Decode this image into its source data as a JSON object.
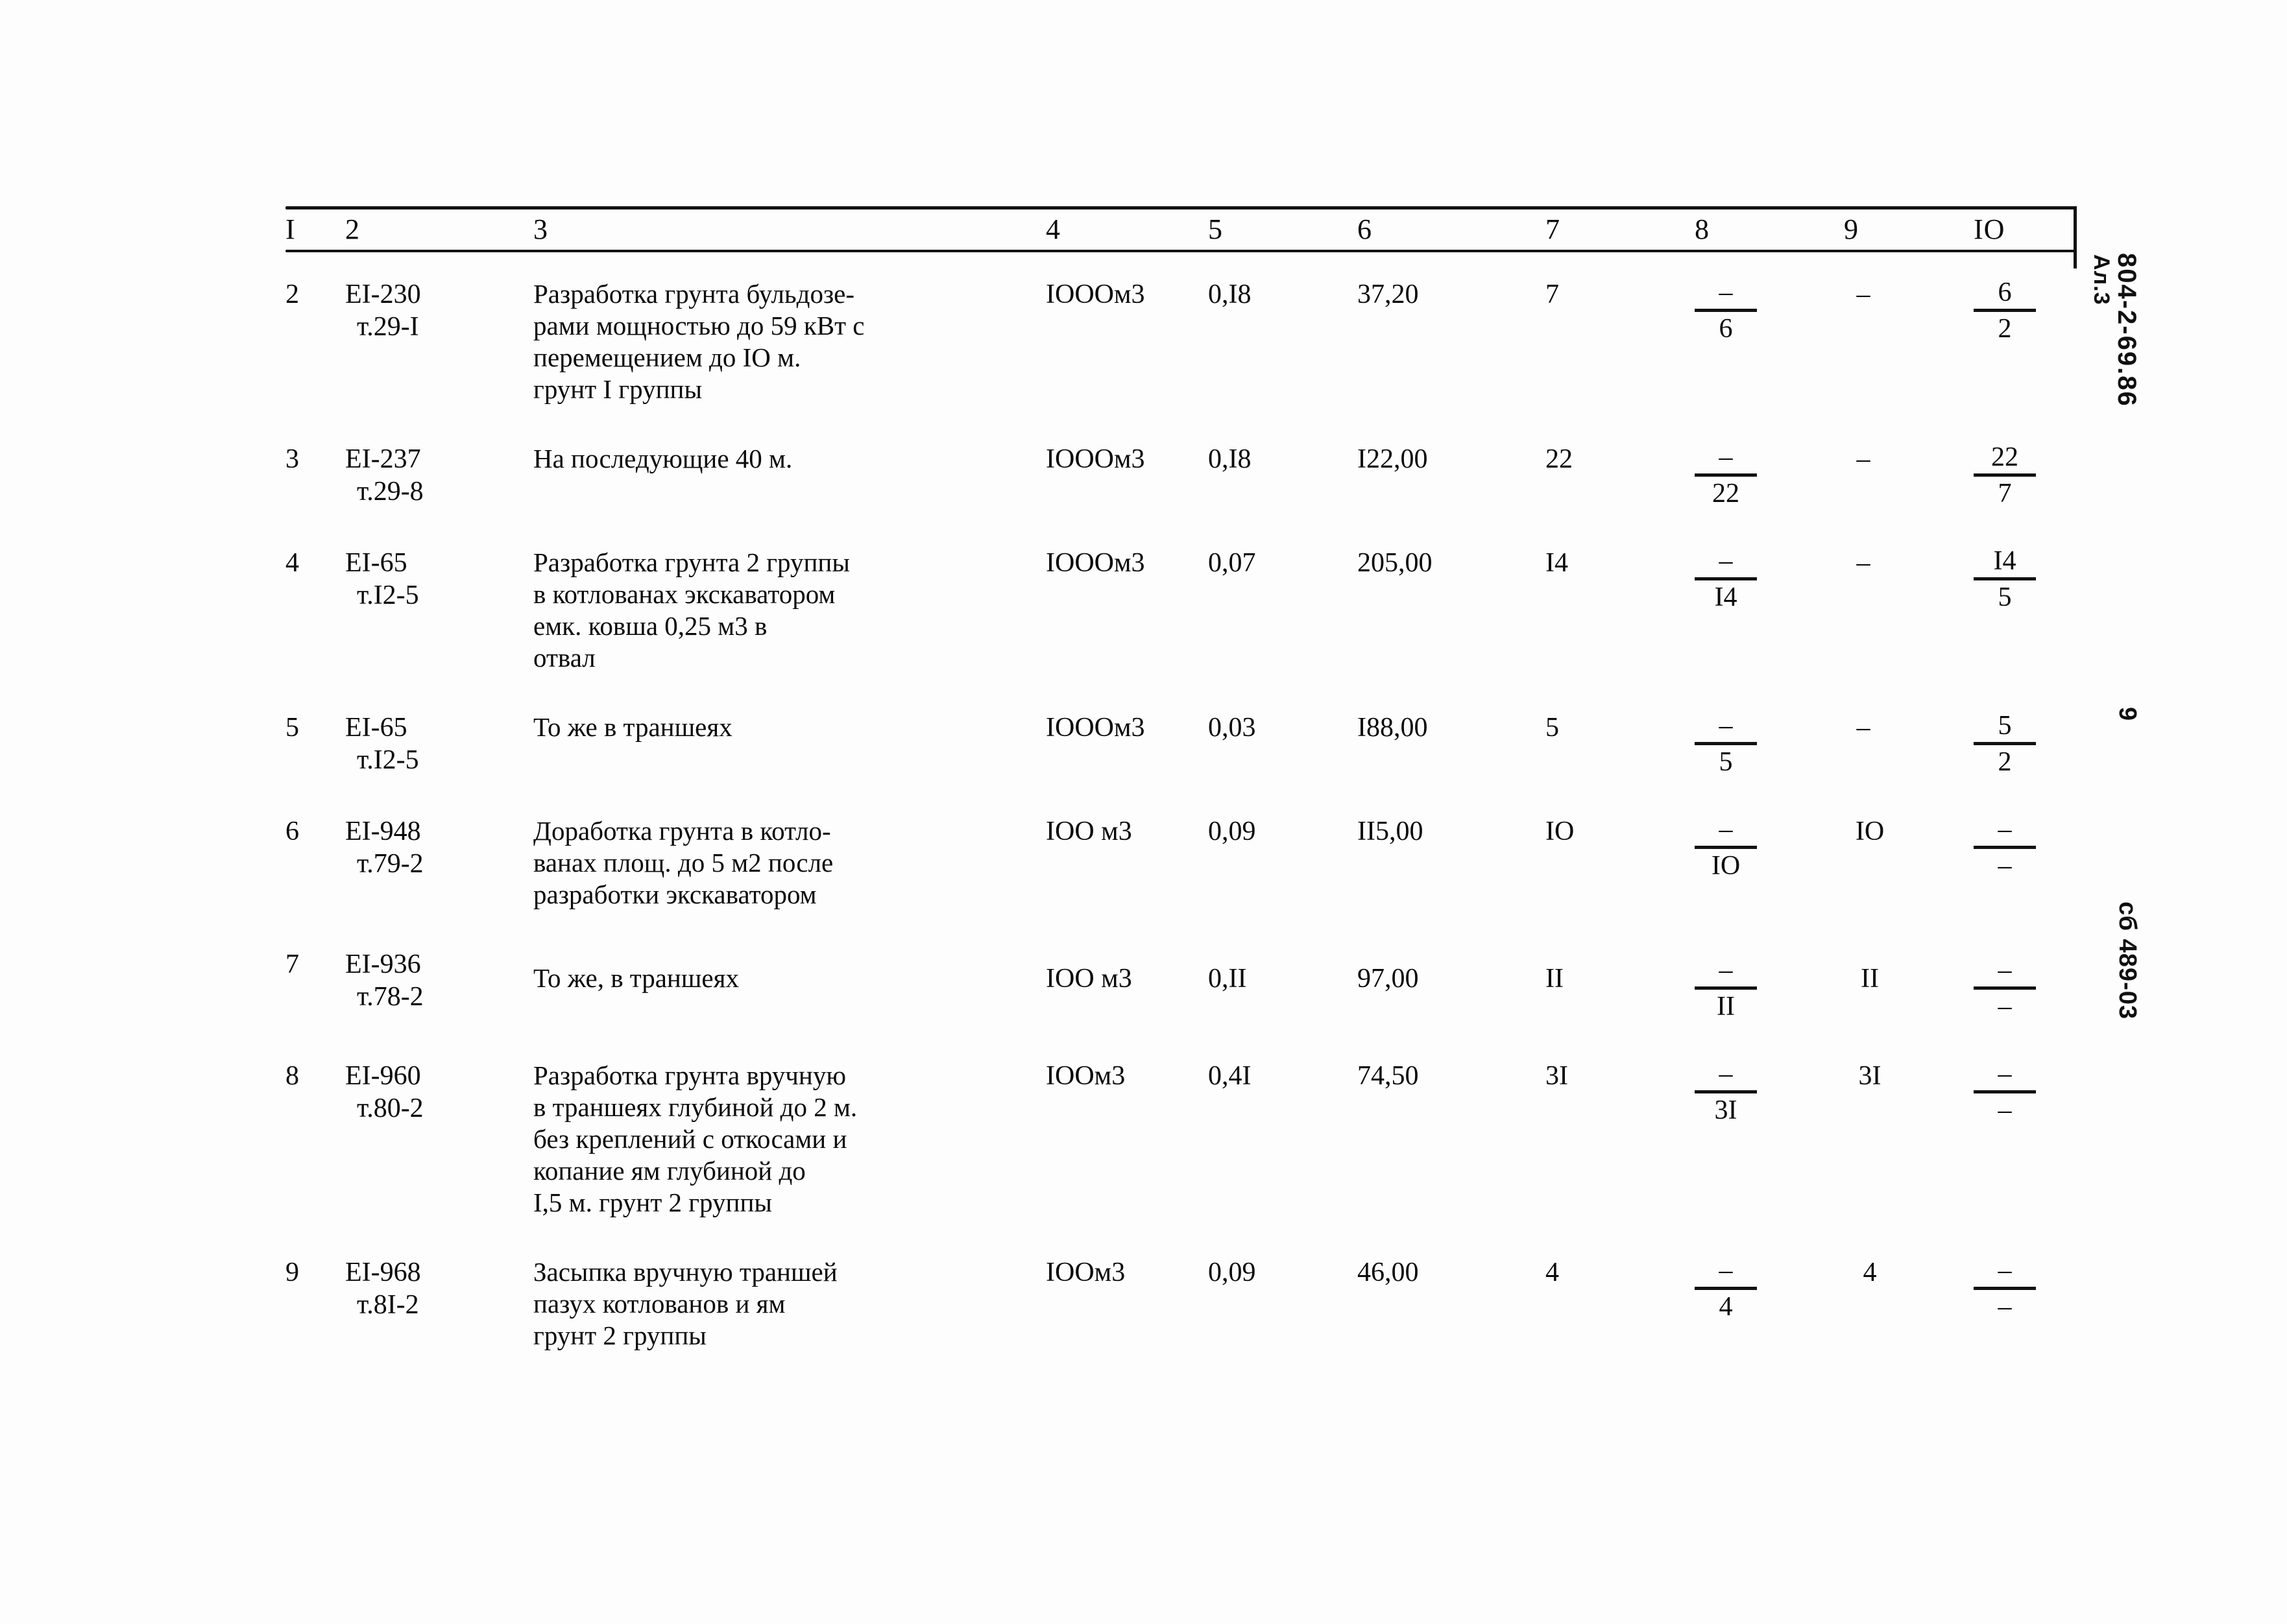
{
  "document": {
    "type": "scanned-estimate-table",
    "columns_header": [
      "I",
      "2",
      "3",
      "4",
      "5",
      "6",
      "7",
      "8",
      "9",
      "IO"
    ],
    "margin_notes": {
      "sheet_label": "Ал.3",
      "document_code": "804-2-69.86",
      "page_number": "9",
      "collection_code": "сб 489-03"
    }
  },
  "rows": [
    {
      "no": "2",
      "code_line1": "EI-230",
      "code_line2": "т.29-I",
      "description": "Разработка грунта бульдозе-\nрами мощностью до 59 кВт с\nперемещением до IO м.\nгрунт I группы",
      "unit": "IООOм3",
      "col5": "0,I8",
      "col6": "37,20",
      "col7": "7",
      "col8": {
        "top": "–",
        "bottom": "6"
      },
      "col9": "–",
      "col10": {
        "top": "6",
        "bottom": "2"
      }
    },
    {
      "no": "3",
      "code_line1": "EI-237",
      "code_line2": "т.29-8",
      "description": "На последующие 40 м.",
      "unit": "IООOм3",
      "col5": "0,I8",
      "col6": "I22,00",
      "col7": "22",
      "col8": {
        "top": "–",
        "bottom": "22"
      },
      "col9": "–",
      "col10": {
        "top": "22",
        "bottom": "7"
      }
    },
    {
      "no": "4",
      "code_line1": "EI-65",
      "code_line2": "т.I2-5",
      "description": "Разработка грунта 2 группы\nв котлованах экскаватором\nемк. ковша 0,25 м3 в\nотвал",
      "unit": "IООOм3",
      "col5": "0,07",
      "col6": "205,00",
      "col7": "I4",
      "col8": {
        "top": "–",
        "bottom": "I4"
      },
      "col9": "–",
      "col10": {
        "top": "I4",
        "bottom": "5"
      }
    },
    {
      "no": "5",
      "code_line1": "EI-65",
      "code_line2": "т.I2-5",
      "description": "То же в траншеях",
      "unit": "IООOм3",
      "col5": "0,03",
      "col6": "I88,00",
      "col7": "5",
      "col8": {
        "top": "–",
        "bottom": "5"
      },
      "col9": "–",
      "col10": {
        "top": "5",
        "bottom": "2"
      }
    },
    {
      "no": "6",
      "code_line1": "EI-948",
      "code_line2": "т.79-2",
      "description": "Доработка грунта в котло-\nванах площ. до 5 м2 после\nразработки экскаватором",
      "unit": "IОО м3",
      "col5": "0,09",
      "col6": "II5,00",
      "col7": "IO",
      "col8": {
        "top": "–",
        "bottom": "IO"
      },
      "col9": "IO",
      "col10": {
        "top": "–",
        "bottom": "–"
      }
    },
    {
      "no": "7",
      "code_line1": "EI-936",
      "code_line2": "т.78-2",
      "description": "То же, в траншеях",
      "unit": "IОО м3",
      "col5": "0,II",
      "col6": "97,00",
      "col7": "II",
      "col8": {
        "top": "–",
        "bottom": "II"
      },
      "col9": "II",
      "col10": {
        "top": "–",
        "bottom": "–"
      }
    },
    {
      "no": "8",
      "code_line1": "EI-960",
      "code_line2": "т.80-2",
      "description": "Разработка грунта вручную\nв траншеях глубиной до 2 м.\nбез креплений с откосами и\nкопание ям глубиной  до\nI,5 м. грунт 2 группы",
      "unit": "IООм3",
      "col5": "0,4I",
      "col6": "74,50",
      "col7": "3I",
      "col8": {
        "top": "–",
        "bottom": "3I"
      },
      "col9": "3I",
      "col10": {
        "top": "–",
        "bottom": "–"
      }
    },
    {
      "no": "9",
      "code_line1": "EI-968",
      "code_line2": "т.8I-2",
      "description": "Засыпка вручную траншей\nпазух котлованов и ям\nгрунт 2 группы",
      "unit": "IООм3",
      "col5": "0,09",
      "col6": "46,00",
      "col7": "4",
      "col8": {
        "top": "–",
        "bottom": "4"
      },
      "col9": "4",
      "col10": {
        "top": "–",
        "bottom": "–"
      }
    }
  ]
}
